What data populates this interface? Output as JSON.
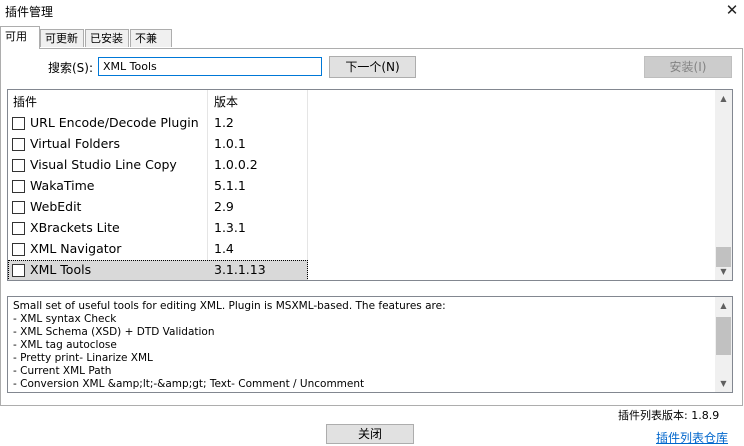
{
  "window": {
    "title": "插件管理",
    "close_glyph": "✕"
  },
  "tabs": [
    {
      "label": "可用",
      "active": true
    },
    {
      "label": "可更新",
      "active": false
    },
    {
      "label": "已安装",
      "active": false
    },
    {
      "label": "不兼容",
      "active": false
    }
  ],
  "search": {
    "label": "搜索(S):",
    "value": "XML Tools"
  },
  "buttons": {
    "next": "下一个(N)",
    "install": "安装(I)",
    "close": "关闭"
  },
  "plugin_list": {
    "columns": [
      "插件",
      "版本"
    ],
    "rows": [
      {
        "name": "URL Encode/Decode Plugin",
        "version": "1.2",
        "checked": false,
        "selected": false
      },
      {
        "name": "Virtual Folders",
        "version": "1.0.1",
        "checked": false,
        "selected": false
      },
      {
        "name": "Visual Studio Line Copy",
        "version": "1.0.0.2",
        "checked": false,
        "selected": false
      },
      {
        "name": "WakaTime",
        "version": "5.1.1",
        "checked": false,
        "selected": false
      },
      {
        "name": "WebEdit",
        "version": "2.9",
        "checked": false,
        "selected": false
      },
      {
        "name": "XBrackets Lite",
        "version": "1.3.1",
        "checked": false,
        "selected": false
      },
      {
        "name": "XML Navigator",
        "version": "1.4",
        "checked": false,
        "selected": false
      },
      {
        "name": "XML Tools",
        "version": "3.1.1.13",
        "checked": false,
        "selected": true
      }
    ]
  },
  "description": {
    "lines": [
      "Small set of useful tools for editing XML. Plugin is MSXML-based. The features are:",
      "- XML syntax Check",
      "- XML Schema (XSD) + DTD Validation",
      "- XML tag autoclose",
      "- Pretty print- Linarize XML",
      "- Current XML Path",
      "- Conversion XML &amp;lt;-&amp;gt; Text- Comment / Uncomment"
    ]
  },
  "footer": {
    "list_version": "插件列表版本:  1.8.9",
    "repo_link": "插件列表仓库"
  }
}
